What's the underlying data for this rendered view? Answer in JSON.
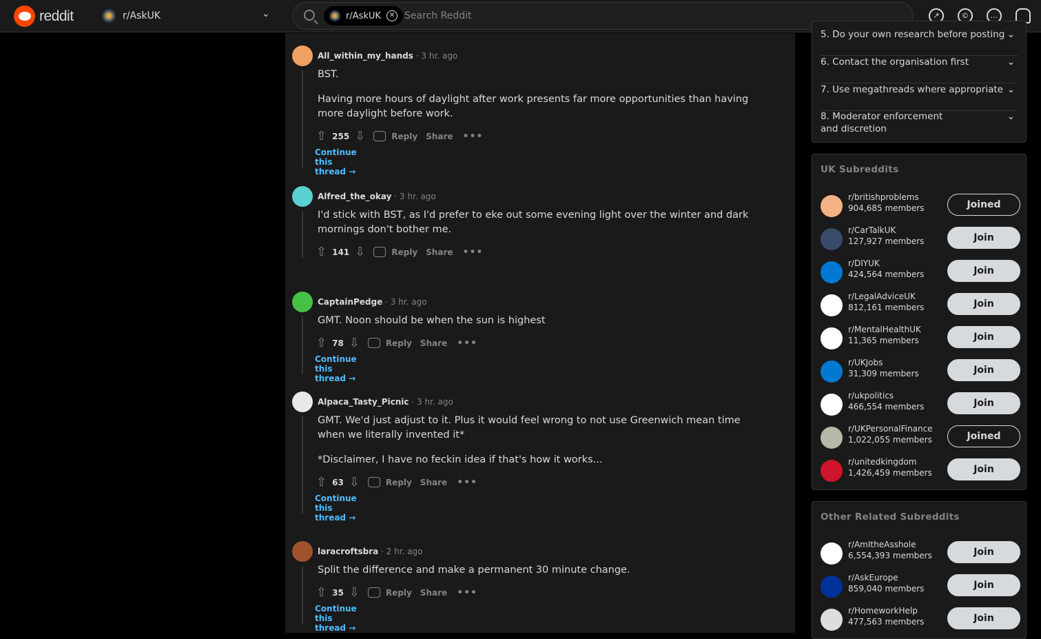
{
  "header": {
    "logo_text": "reddit",
    "community": "r/AskUK",
    "search_chip": "r/AskUK",
    "search_placeholder": "Search Reddit",
    "icons": [
      "popular-icon",
      "coins-icon",
      "chat-icon",
      "notification-icon"
    ]
  },
  "comments": [
    {
      "author": "All_within_my_hands",
      "time": "3 hr. ago",
      "paragraphs": [
        "BST.",
        "Having more hours of daylight after work presents far more opportunities than having more daylight before work."
      ],
      "votes": "255",
      "reply": "Reply",
      "share": "Share",
      "continue": "Continue this thread",
      "avatar_color": "#f0a060"
    },
    {
      "author": "Alfred_the_okay",
      "time": "3 hr. ago",
      "paragraphs": [
        "I'd stick with BST, as I'd prefer to eke out some evening light over the winter and dark mornings don't bother me."
      ],
      "votes": "141",
      "reply": "Reply",
      "share": "Share",
      "continue": "",
      "avatar_color": "#5ad0d0"
    },
    {
      "author": "CaptainPedge",
      "time": "3 hr. ago",
      "paragraphs": [
        "GMT. Noon should be when the sun is highest"
      ],
      "votes": "78",
      "reply": "Reply",
      "share": "Share",
      "continue": "Continue this thread",
      "avatar_color": "#46c046"
    },
    {
      "author": "Alpaca_Tasty_Picnic",
      "time": "3 hr. ago",
      "paragraphs": [
        "GMT. We'd just adjust to it. Plus it would feel wrong to not use Greenwich mean time when we literally invented it*",
        "*Disclaimer, I have no feckin idea if that's how it works..."
      ],
      "votes": "63",
      "reply": "Reply",
      "share": "Share",
      "continue": "Continue this thread",
      "avatar_color": "#e8e8e8"
    },
    {
      "author": "laracroftsbra",
      "time": "2 hr. ago",
      "paragraphs": [
        "Split the difference and make a permanent 30 minute change."
      ],
      "votes": "35",
      "reply": "Reply",
      "share": "Share",
      "continue": "Continue this thread",
      "avatar_color": "#a0522d"
    }
  ],
  "rules": [
    "5. Do your own research before posting",
    "6. Contact the organisation first",
    "7. Use megathreads where appropriate",
    "8. Moderator enforcement and discretion"
  ],
  "uk_subreddits": {
    "title": "UK Subreddits",
    "items": [
      {
        "name": "r/britishproblems",
        "members": "904,685 members",
        "button": "Joined",
        "color": "#f4b183"
      },
      {
        "name": "r/CarTalkUK",
        "members": "127,927 members",
        "button": "Join",
        "color": "#3a4a6a"
      },
      {
        "name": "r/DIYUK",
        "members": "424,564 members",
        "button": "Join",
        "color": "#0079d3"
      },
      {
        "name": "r/LegalAdviceUK",
        "members": "812,161 members",
        "button": "Join",
        "color": "#ffffff"
      },
      {
        "name": "r/MentalHealthUK",
        "members": "11,365 members",
        "button": "Join",
        "color": "#ffffff"
      },
      {
        "name": "r/UKJobs",
        "members": "31,309 members",
        "button": "Join",
        "color": "#0079d3"
      },
      {
        "name": "r/ukpolitics",
        "members": "466,554 members",
        "button": "Join",
        "color": "#ffffff"
      },
      {
        "name": "r/UKPersonalFinance",
        "members": "1,022,055 members",
        "button": "Joined",
        "color": "#b8b8a8"
      },
      {
        "name": "r/unitedkingdom",
        "members": "1,426,459 members",
        "button": "Join",
        "color": "#cf142b"
      }
    ]
  },
  "other_subreddits": {
    "title": "Other Related Subreddits",
    "items": [
      {
        "name": "r/AmItheAsshole",
        "members": "6,554,393 members",
        "button": "Join",
        "color": "#ffffff"
      },
      {
        "name": "r/AskEurope",
        "members": "859,040 members",
        "button": "Join",
        "color": "#003399"
      },
      {
        "name": "r/HomeworkHelp",
        "members": "477,563 members",
        "button": "Join",
        "color": "#dddddd"
      }
    ]
  }
}
